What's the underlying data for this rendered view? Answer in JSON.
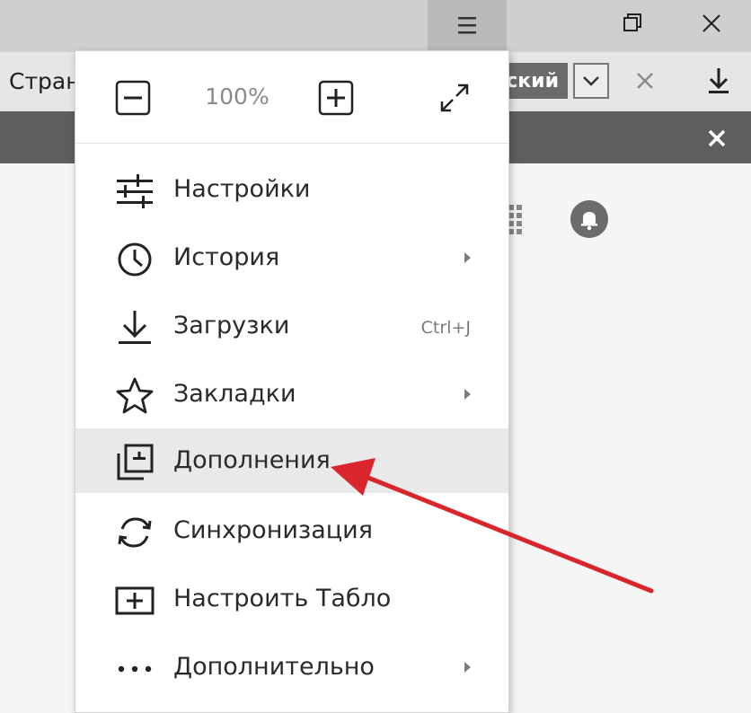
{
  "infobar": {
    "label": "Стран",
    "language_button": "ский"
  },
  "zoom": {
    "value": "100%"
  },
  "menu": {
    "items": [
      {
        "label": "Настройки"
      },
      {
        "label": "История"
      },
      {
        "label": "Загрузки",
        "shortcut": "Ctrl+J"
      },
      {
        "label": "Закладки"
      },
      {
        "label": "Дополнения"
      },
      {
        "label": "Синхронизация"
      },
      {
        "label": "Настроить Табло"
      },
      {
        "label": "Дополнительно"
      }
    ]
  },
  "colors": {
    "annotation_arrow": "#d9262c",
    "highlight": "#e9e9e9",
    "dark_strip": "#5e5e5e"
  }
}
